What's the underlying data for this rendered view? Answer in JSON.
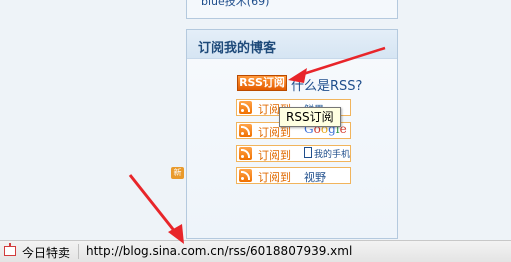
{
  "top_panel": {
    "partial_link": "blue技术(69)"
  },
  "subscribe_box": {
    "title": "订阅我的博客",
    "rss_button": "RSS订阅",
    "what_is_rss": "什么是RSS?",
    "subscribe_to": "订阅到",
    "services": [
      {
        "name": "鲜果",
        "icon": "xianguo-icon"
      },
      {
        "name": "Google",
        "icon": "google-icon"
      },
      {
        "name": "我的手机",
        "icon": "mobile-icon"
      },
      {
        "name": "视野",
        "icon": "shiye-icon"
      }
    ],
    "new_badge": "新"
  },
  "tooltip": {
    "text": "RSS订阅"
  },
  "status_bar": {
    "deals_label": "今日特卖",
    "url": "http://blog.sina.com.cn/rss/6018807939.xml"
  },
  "colors": {
    "accent": "#e06a00",
    "link": "#1f4e8c",
    "arrow": "#e8252a"
  }
}
